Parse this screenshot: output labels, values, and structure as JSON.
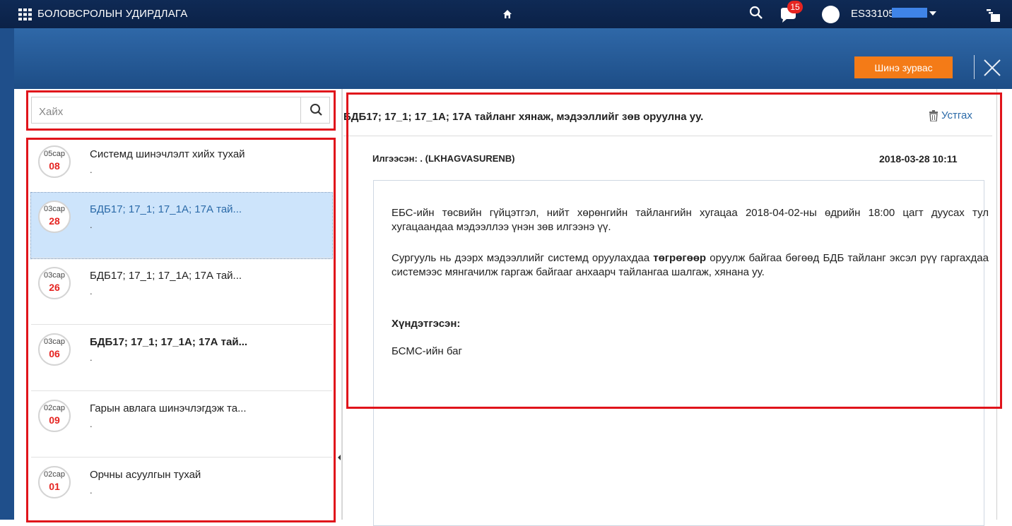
{
  "topbar": {
    "app_title": "БОЛОВСРОЛЫН УДИРДЛАГА",
    "notification_count": "15",
    "username": "ES331055",
    "icons": [
      "apps-grid-icon",
      "home-icon",
      "search-icon",
      "notification-bell-icon",
      "avatar",
      "chevron-down-icon",
      "window-switch-icon"
    ]
  },
  "toolbar": {
    "new_message_label": "Шинэ зурвас",
    "close_icon": "close-icon"
  },
  "search": {
    "placeholder": "Хайх"
  },
  "messages": [
    {
      "month": "05сар",
      "day": "08",
      "subject": "Системд шинэчлэлт хийх тухай",
      "preview": "."
    },
    {
      "month": "03сар",
      "day": "28",
      "subject": "БДБ17; 17_1; 17_1А; 17А тай...",
      "preview": "."
    },
    {
      "month": "03сар",
      "day": "26",
      "subject": "БДБ17; 17_1; 17_1А; 17А тай...",
      "preview": "."
    },
    {
      "month": "03сар",
      "day": "06",
      "subject": "БДБ17; 17_1; 17_1А; 17А тай...",
      "preview": "."
    },
    {
      "month": "02сар",
      "day": "09",
      "subject": "Гарын авлага шинэчлэгдэж та...",
      "preview": "."
    },
    {
      "month": "02сар",
      "day": "01",
      "subject": "Орчны асуулгын тухай",
      "preview": "."
    }
  ],
  "detail": {
    "title": "БДБ17; 17_1; 17_1А; 17А тайланг хянаж, мэдээллийг зөв оруулна уу.",
    "delete_label": "Устгах",
    "sender": "Илгээсэн: . (LKHAGVASURENB)",
    "date": "2018-03-28 10:11",
    "body": {
      "p1": "ЕБС-ийн төсвийн гүйцэтгэл, нийт хөрөнгийн тайлангийн хугацаа 2018-04-02-ны өдрийн 18:00 цагт дуусах тул хугацаандаа мэдээллээ үнэн зөв илгээнэ үү.",
      "p2_before": "Сургууль нь  дээрх мэдээллийг  системд оруулахдаа ",
      "p2_bold": "төгрөгөөр",
      "p2_after": " оруулж байгаа бөгөөд БДБ тайланг эксэл рүү гаргахдаа системээс мянгачилж гаргаж байгааг анхаарч тайлангаа шалгаж, хянана уу.",
      "greeting": "Хүндэтгэсэн:",
      "signature": "БСМС-ийн баг"
    }
  },
  "colors": {
    "topbar": "#0f2a55",
    "band": "#2f68a8",
    "accent_button": "#f47b17",
    "badge": "#e52421",
    "selected_row": "#cde4fb",
    "link": "#2b6aa8",
    "highlight_box": "#e0141b"
  }
}
